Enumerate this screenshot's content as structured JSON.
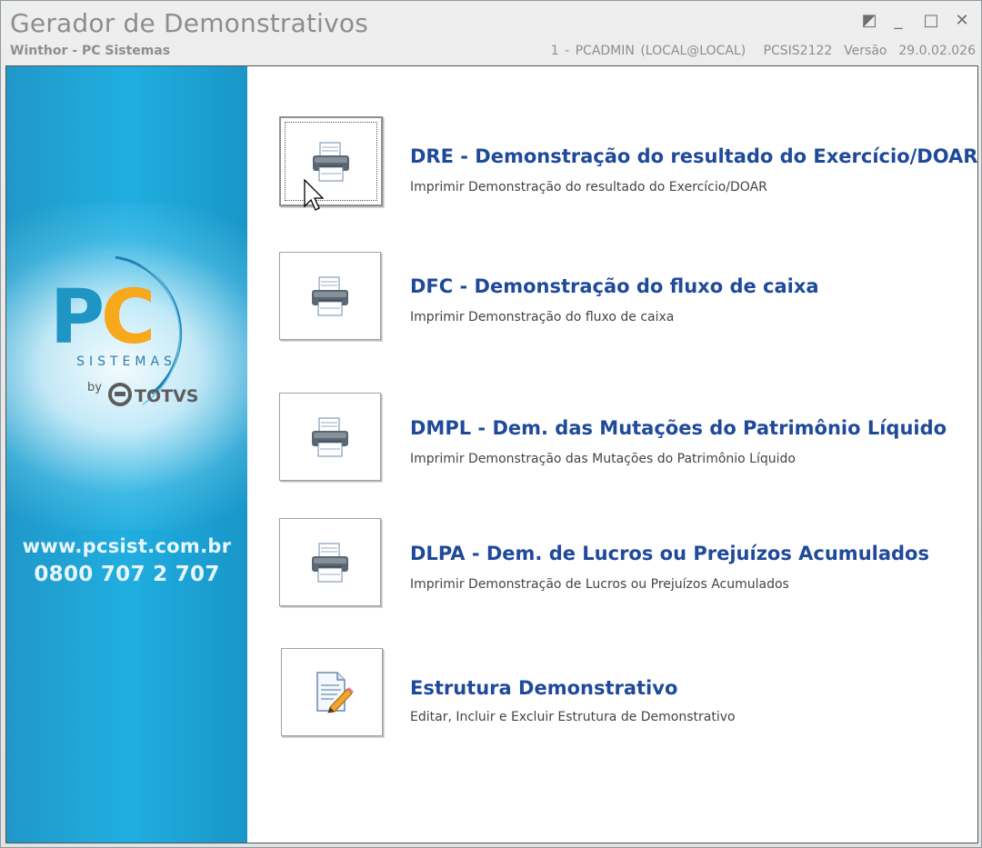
{
  "window": {
    "title": "Gerador de Demonstrativos",
    "subtitle": "Winthor - PC Sistemas",
    "status": "1 - PCADMIN (LOCAL@LOCAL)   PCSIS2122  Versão  29.0.02.026",
    "controls": {
      "restore": "◩",
      "minimize": "_",
      "maximize": "□",
      "close": "✕"
    }
  },
  "banner": {
    "logo_letters": "PC",
    "logo_word": "SISTEMAS",
    "by": "by",
    "totvs": "TOTVS",
    "website": "www.pcsist.com.br",
    "phone": "0800 707 2 707",
    "colors": {
      "bg": "#20aee0",
      "logo_p": "#1f95c4",
      "logo_c": "#f7a81b"
    }
  },
  "items": [
    {
      "title": "DRE - Demonstração do resultado do Exercício/DOAR",
      "description": "Imprimir Demonstração do resultado do Exercício/DOAR",
      "icon": "printer-icon"
    },
    {
      "title": "DFC - Demonstração do fluxo de caixa",
      "description": "Imprimir Demonstração do fluxo de caixa",
      "icon": "printer-icon"
    },
    {
      "title": "DMPL - Dem. das Mutações do Patrimônio Líquido",
      "description": "Imprimir Demonstração das Mutações do Patrimônio Líquido",
      "icon": "printer-icon"
    },
    {
      "title": "DLPA - Dem. de Lucros ou Prejuízos Acumulados",
      "description": "Imprimir Demonstração de Lucros ou Prejuízos Acumulados",
      "icon": "printer-icon"
    },
    {
      "title": "Estrutura Demonstrativo",
      "description": "Editar, Incluir e Excluir Estrutura de Demonstrativo",
      "icon": "document-edit-icon"
    }
  ]
}
